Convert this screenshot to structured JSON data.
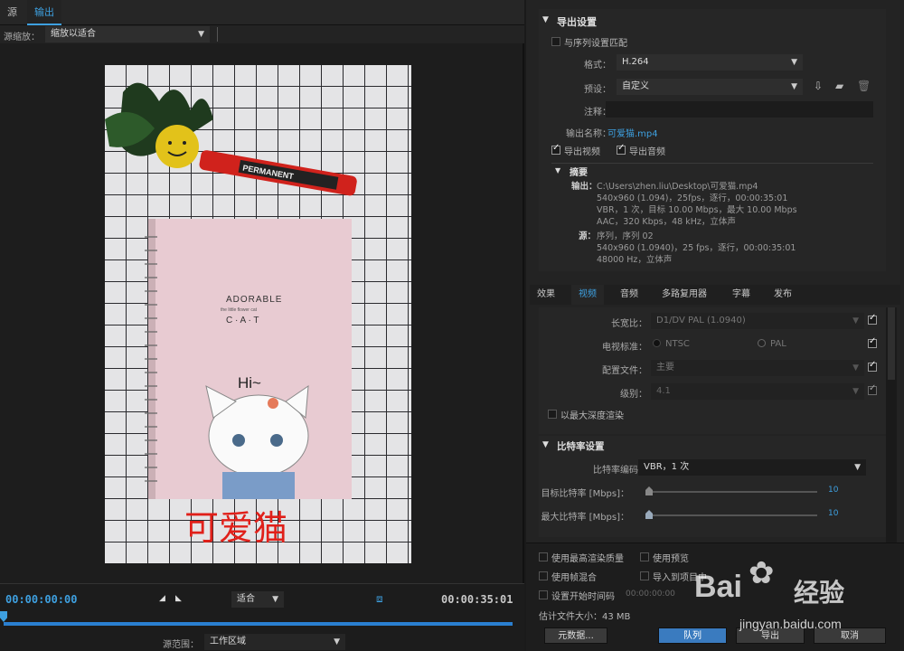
{
  "tabs": {
    "source": "源",
    "output": "输出"
  },
  "source_scale": {
    "label": "源缩放：",
    "value": "缩放以适合"
  },
  "preview": {
    "text_adorable": "ADORABLE",
    "text_subtitle": "the little flower cat",
    "text_cat": "C · A · T",
    "text_hi": "Hi~",
    "marker_brand": "PERMANENT",
    "marker_small": "Comnic ma",
    "caption": "可爱猫"
  },
  "timeline": {
    "current_time": "00:00:00:00",
    "fit": "适合",
    "end_time": "00:00:35:01",
    "range_label": "源范围：",
    "range_value": "工作区域"
  },
  "export_settings": {
    "title": "导出设置",
    "match_sequence": "与序列设置匹配",
    "format_label": "格式：",
    "format_value": "H.264",
    "preset_label": "预设：",
    "preset_value": "自定义",
    "comment_label": "注释：",
    "output_name_label": "输出名称：",
    "output_name_value": "可爱猫.mp4",
    "export_video": "导出视频",
    "export_audio": "导出音频"
  },
  "summary": {
    "title": "摘要",
    "output_label": "输出：",
    "output_lines": [
      "C:\\Users\\zhen.liu\\Desktop\\可爱猫.mp4",
      "540x960 (1.094)，25fps，逐行，00:00:35:01",
      "VBR，1 次，目标 10.00 Mbps，最大 10.00 Mbps",
      "AAC，320 Kbps，48 kHz，立体声"
    ],
    "source_label": "源：",
    "source_lines": [
      "序列，序列 02",
      "540x960 (1.0940)，25 fps，逐行，00:00:35:01",
      "48000 Hz，立体声"
    ]
  },
  "sub_tabs": [
    "效果",
    "视频",
    "音频",
    "多路复用器",
    "字幕",
    "发布"
  ],
  "video": {
    "aspect_label": "长宽比：",
    "aspect_value": "D1/DV PAL (1.0940)",
    "tv_label": "电视标准：",
    "tv_ntsc": "NTSC",
    "tv_pal": "PAL",
    "profile_label": "配置文件：",
    "profile_value": "主要",
    "level_label": "级别：",
    "level_value": "4.1",
    "max_depth": "以最大深度渲染"
  },
  "bitrate": {
    "title": "比特率设置",
    "encoding_label": "比特率编码：",
    "encoding_value": "VBR，1 次",
    "target_label": "目标比特率 [Mbps]：",
    "target_value": "10",
    "max_label": "最大比特率 [Mbps]：",
    "max_value": "10"
  },
  "options": {
    "max_render_quality": "使用最高渲染质量",
    "use_preview": "使用预览",
    "frame_blend": "使用帧混合",
    "import_project": "导入到项目中",
    "set_start_tc": "设置开始时间码",
    "start_tc_value": "00:00:00:00",
    "file_size": "估计文件大小：43 MB"
  },
  "buttons": {
    "metadata": "元数据...",
    "queue": "队列",
    "export": "导出",
    "cancel": "取消"
  },
  "watermark": {
    "brand": "Bai",
    "brand2": "经验",
    "url": "jingyan.baidu.com"
  }
}
